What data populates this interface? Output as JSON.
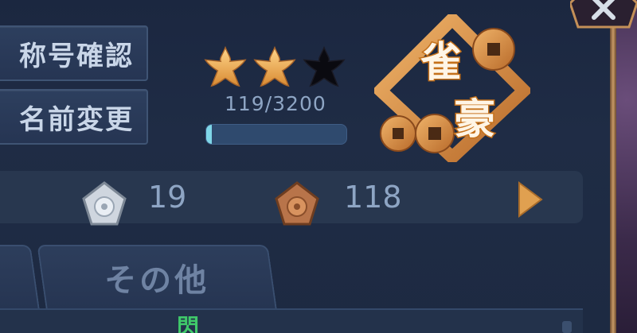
{
  "buttons": {
    "title_confirm_label": "称号確認",
    "rename_label": "名前変更"
  },
  "rank": {
    "stars_filled": 2,
    "stars_total": 3,
    "progress_text": "119/3200",
    "progress_current": 119,
    "progress_max": 3200,
    "emblem_text_top": "雀",
    "emblem_text_bottom": "豪"
  },
  "stats": {
    "silver_count": "19",
    "bronze_count": "118"
  },
  "tabs": {
    "other_label": "その他"
  },
  "content": {
    "partial_glyph": "閃"
  },
  "icons": {
    "close": "close-icon",
    "star": "star-icon",
    "silver_badge": "silver-sakura-badge-icon",
    "bronze_badge": "bronze-sakura-badge-icon",
    "next": "chevron-right-icon"
  },
  "colors": {
    "accent_gold": "#e8b060",
    "progress_fill": "#7fd6e8",
    "text_muted": "#8ea5c4"
  }
}
